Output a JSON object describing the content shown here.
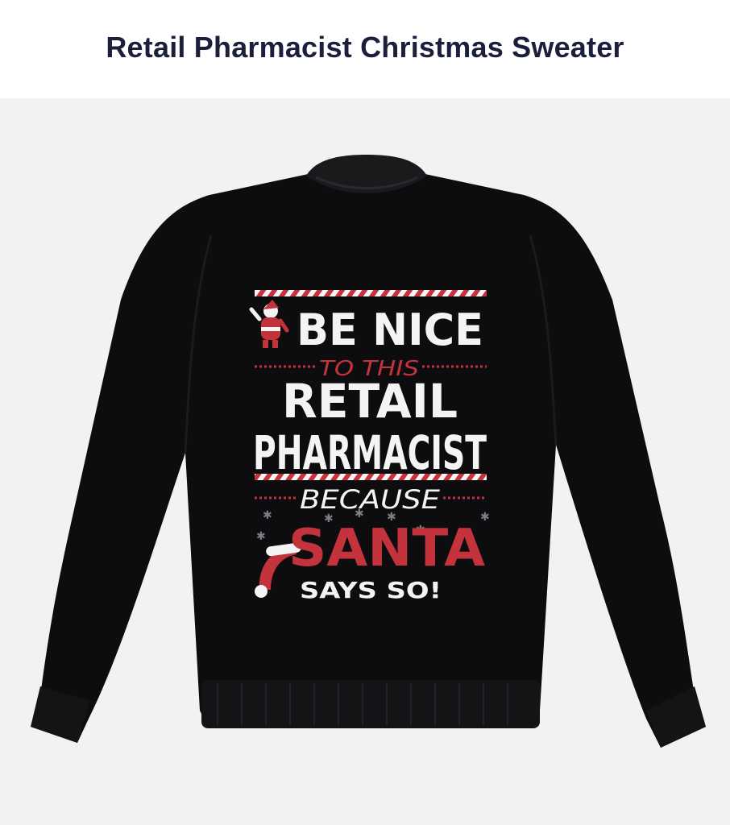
{
  "product": {
    "title": "Retail Pharmacist Christmas Sweater"
  },
  "design": {
    "line1": "BE NICE",
    "line2": "TO THIS",
    "line3": "RETAIL",
    "line4": "PHARMACIST",
    "line5": "BECAUSE",
    "line6": "SANTA",
    "line7": "SAYS SO!"
  },
  "colors": {
    "sweater": "#0d0d0f",
    "accent_red": "#c4333b",
    "print_white": "#f4f4f4",
    "title_text": "#1b1f3b",
    "background": "#f2f2f4"
  }
}
